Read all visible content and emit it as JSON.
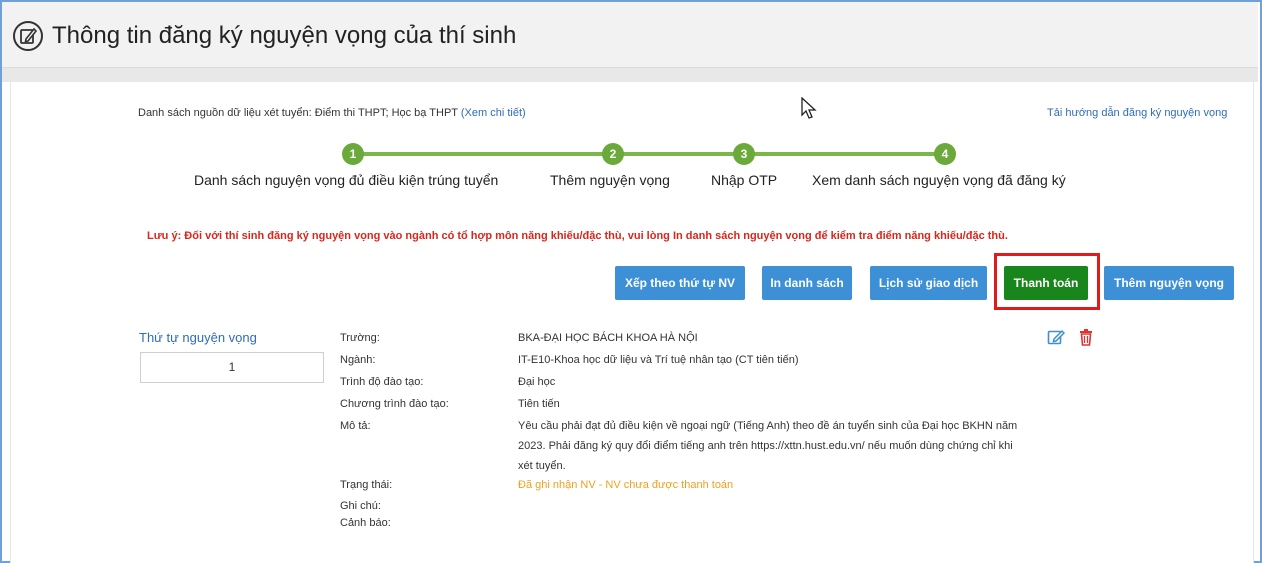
{
  "header": {
    "title": "Thông tin đăng ký nguyện vọng của thí sinh"
  },
  "data_source": {
    "text": "Danh sách nguồn dữ liệu xét tuyển: Điểm thi THPT; Học bạ THPT",
    "detail_link": "(Xem chi tiết)"
  },
  "guide_link": "Tải hướng dẫn đăng ký nguyện vọng",
  "steps": [
    {
      "number": "1",
      "label": "Danh sách nguyện vọng đủ điều kiện trúng tuyển"
    },
    {
      "number": "2",
      "label": "Thêm nguyện vọng"
    },
    {
      "number": "3",
      "label": "Nhập OTP"
    },
    {
      "number": "4",
      "label": "Xem danh sách nguyện vọng đã đăng ký"
    }
  ],
  "note": "Lưu ý: Đối với thí sinh đăng ký nguyện vọng vào ngành có tổ hợp môn năng khiếu/đặc thù, vui lòng In danh sách nguyện vọng để kiểm tra điểm năng khiếu/đặc thù.",
  "buttons": {
    "sort": "Xếp theo thứ tự NV",
    "print": "In danh sách",
    "history": "Lịch sử giao dịch",
    "pay": "Thanh toán",
    "add": "Thêm nguyện vọng"
  },
  "order": {
    "label": "Thứ tự nguyện vọng",
    "value": "1"
  },
  "record": {
    "school_label": "Trường:",
    "school_value": "BKA-ĐẠI HỌC BÁCH KHOA HÀ NỘI",
    "major_label": "Ngành:",
    "major_value": "IT-E10-Khoa học dữ liệu và Trí tuệ nhân tạo (CT tiên tiến)",
    "level_label": "Trình độ đào tạo:",
    "level_value": "Đại học",
    "program_label": "Chương trình đào tạo:",
    "program_value": "Tiên tiến",
    "desc_label": "Mô tả:",
    "desc_value": "Yêu cầu phải đạt đủ điều kiện về ngoại ngữ (Tiếng Anh) theo đề án tuyển sinh của Đại học BKHN năm 2023. Phải đăng ký quy đổi điểm tiếng anh trên https://xttn.hust.edu.vn/ nếu muốn dùng chứng chỉ khi xét tuyển.",
    "status_label": "Trạng thái:",
    "status_value": "Đã ghi nhận NV - NV chưa được thanh toán",
    "notes_label": "Ghi chú:",
    "warning_label": "Cảnh báo:"
  },
  "colors": {
    "primary_button": "#3d8fd6",
    "pay_button": "#18861a",
    "step_green": "#6aa93a",
    "note_red": "#d9261c",
    "status_orange": "#f0a020",
    "highlight_box": "#e01b1b"
  }
}
